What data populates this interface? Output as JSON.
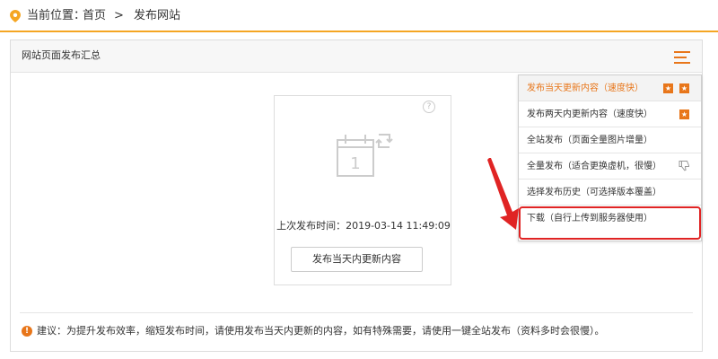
{
  "breadcrumb": {
    "label": "当前位置：",
    "home": "首页",
    "separator": ">",
    "current": "发布网站"
  },
  "panel": {
    "title": "网站页面发布汇总"
  },
  "card": {
    "help": "?",
    "calendar_day": "1",
    "last_publish": "上次发布时间：2019-03-14 11:49:09",
    "button_label": "发布当天内更新内容"
  },
  "tip": {
    "icon": "!",
    "text": "建议：为提升发布效率，缩短发布时间，请使用发布当天内更新的内容，如有特殊需要，请使用一键全站发布（资料多时会很慢）。"
  },
  "menu": {
    "items": [
      {
        "label": "发布当天更新内容（速度快）",
        "badge": "star-star"
      },
      {
        "label": "发布两天内更新内容（速度快）",
        "badge": "star"
      },
      {
        "label": "全站发布（页面全量图片增量）",
        "badge": ""
      },
      {
        "label": "全量发布（适合更换虚机，很慢）",
        "badge": "thumb-down"
      },
      {
        "label": "选择发布历史（可选择版本覆盖）",
        "badge": ""
      },
      {
        "label": "下载（自行上传到服务器使用）",
        "badge": ""
      }
    ],
    "star_glyph": "★"
  },
  "colors": {
    "accent": "#e8761a",
    "topbar_border": "#f5a623",
    "annotation": "#e02424"
  }
}
